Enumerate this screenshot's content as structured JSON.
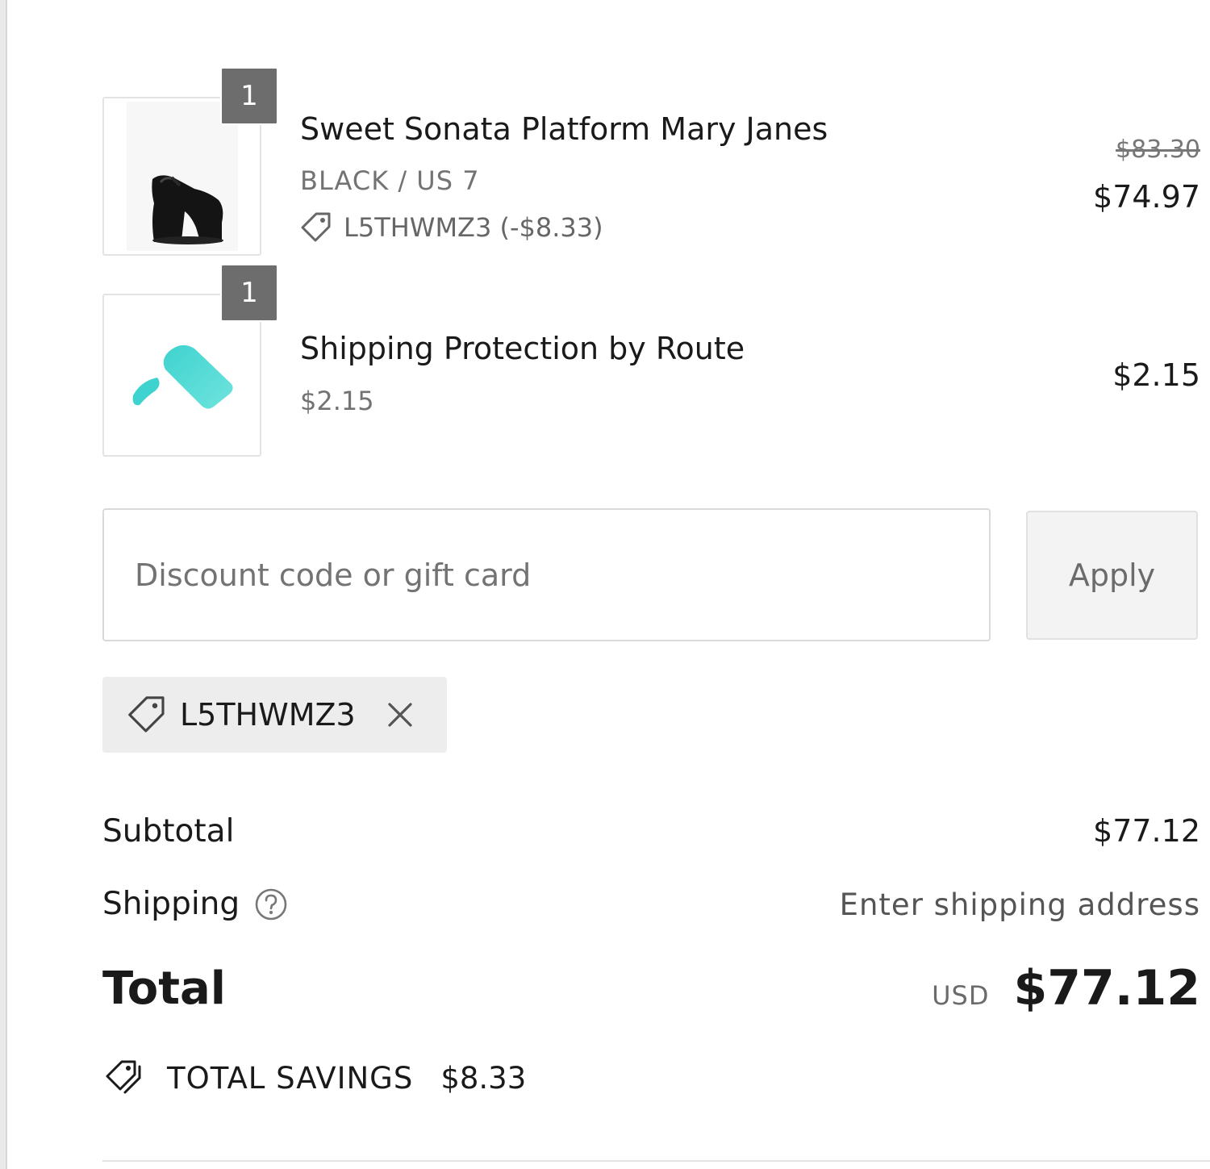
{
  "line_items": [
    {
      "quantity": "1",
      "title": "Sweet Sonata Platform Mary Janes",
      "variant": "BLACK / US 7",
      "discount": "L5THWMZ3 (-$8.33)",
      "original_price": "$83.30",
      "price": "$74.97",
      "image_icon": "platform-shoe-icon"
    },
    {
      "quantity": "1",
      "title": "Shipping Protection by Route",
      "subtitle": "$2.15",
      "price": "$2.15",
      "image_icon": "route-logo-icon"
    }
  ],
  "discount": {
    "placeholder": "Discount code or gift card",
    "value": "",
    "apply_label": "Apply",
    "applied_code": "L5THWMZ3"
  },
  "summary": {
    "subtotal_label": "Subtotal",
    "subtotal_value": "$77.12",
    "shipping_label": "Shipping",
    "shipping_value": "Enter shipping address",
    "total_label": "Total",
    "total_currency": "USD",
    "total_value": "$77.12",
    "savings_label": "TOTAL SAVINGS",
    "savings_value": "$8.33"
  },
  "colors": {
    "route_teal": "#3fd3cf",
    "badge_gray": "#6d6d6d",
    "muted_text": "#737373"
  }
}
